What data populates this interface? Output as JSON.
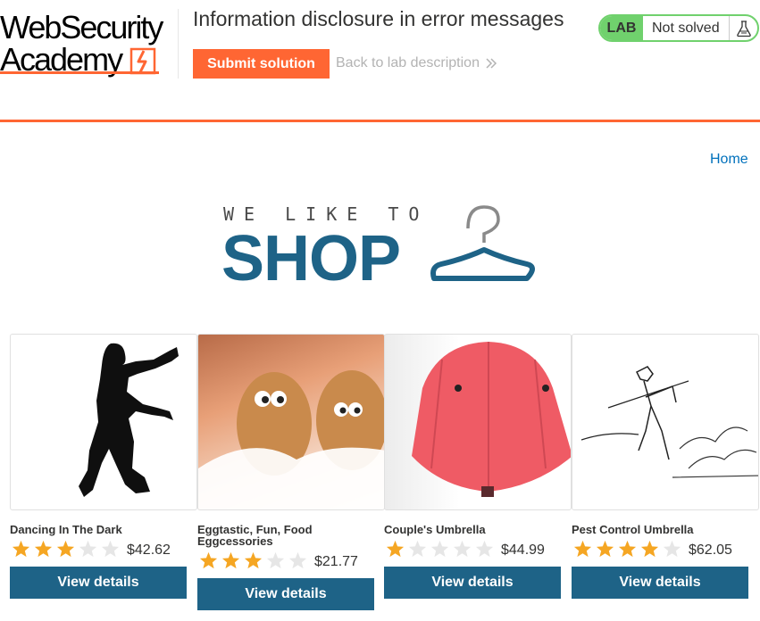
{
  "header": {
    "logo_line1": "WebSecurity",
    "logo_line2": "Academy",
    "lab_title": "Information disclosure in error messages",
    "submit_label": "Submit solution",
    "back_label": "Back to lab description",
    "status_badge": "LAB",
    "status_text": "Not solved",
    "status_icon": "flask-icon"
  },
  "nav": {
    "home_label": "Home"
  },
  "banner": {
    "tagline": "WE LIKE TO",
    "title": "SHOP"
  },
  "products": [
    {
      "name": "Dancing In The Dark",
      "rating": 3,
      "price": "$42.62",
      "button": "View details",
      "image": "dancing-silhouette"
    },
    {
      "name": "Eggtastic, Fun, Food Eggcessories",
      "rating": 3,
      "price": "$21.77",
      "button": "View details",
      "image": "eggs-with-eyes"
    },
    {
      "name": "Couple's Umbrella",
      "rating": 1,
      "price": "$44.99",
      "button": "View details",
      "image": "red-double-umbrella"
    },
    {
      "name": "Pest Control Umbrella",
      "rating": 4,
      "price": "$62.05",
      "button": "View details",
      "image": "umbrella-sketch"
    }
  ],
  "colors": {
    "accent": "#ff6633",
    "primary": "#1e6387",
    "status_green": "#70d16d",
    "star_on": "#f5a623",
    "star_off": "#e6e6e6",
    "link": "#0071bc"
  }
}
